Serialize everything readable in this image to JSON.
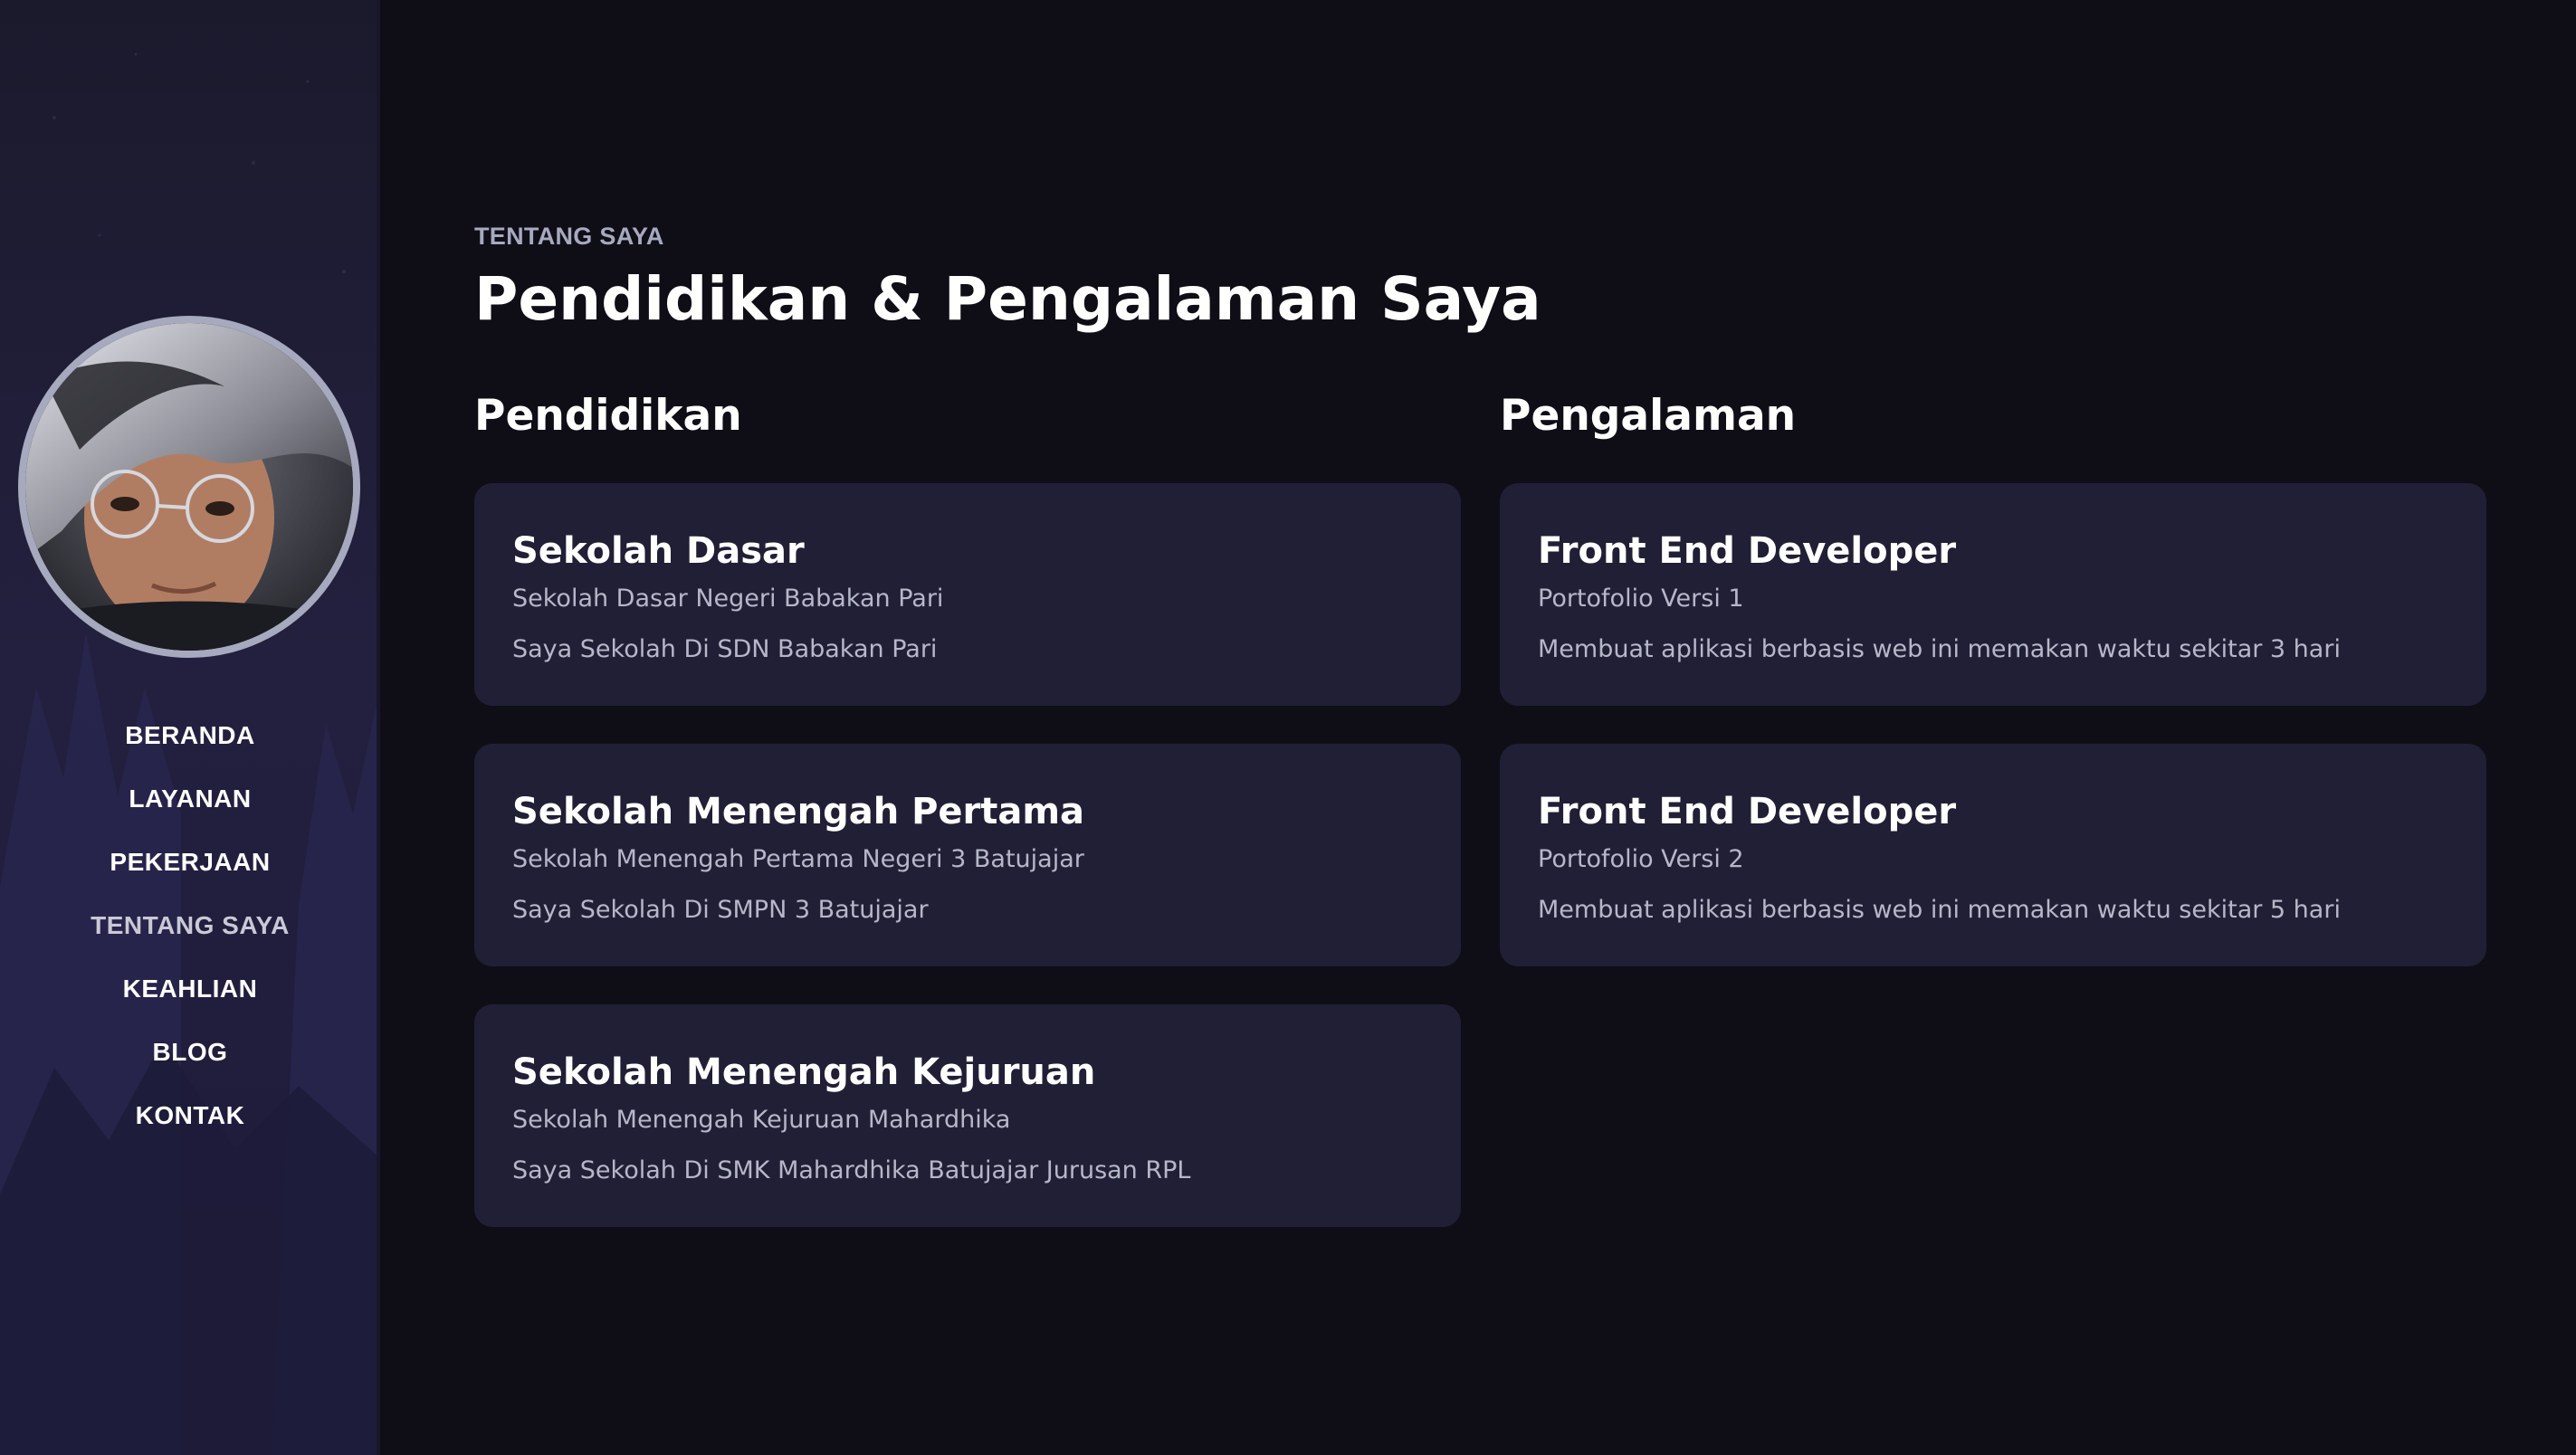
{
  "sidebar": {
    "avatar_alt": "profile photo",
    "nav": [
      {
        "label": "BERANDA",
        "active": false
      },
      {
        "label": "LAYANAN",
        "active": false
      },
      {
        "label": "PEKERJAAN",
        "active": false
      },
      {
        "label": "TENTANG SAYA",
        "active": true
      },
      {
        "label": "KEAHLIAN",
        "active": false
      },
      {
        "label": "BLOG",
        "active": false
      },
      {
        "label": "KONTAK",
        "active": false
      }
    ]
  },
  "main": {
    "eyebrow": "TENTANG SAYA",
    "title": "Pendidikan & Pengalaman Saya",
    "education": {
      "heading": "Pendidikan",
      "items": [
        {
          "title": "Sekolah Dasar",
          "subtitle": "Sekolah Dasar Negeri Babakan Pari",
          "description": "Saya Sekolah Di SDN Babakan Pari"
        },
        {
          "title": "Sekolah Menengah Pertama",
          "subtitle": "Sekolah Menengah Pertama Negeri 3 Batujajar",
          "description": "Saya Sekolah Di SMPN 3 Batujajar"
        },
        {
          "title": "Sekolah Menengah Kejuruan",
          "subtitle": "Sekolah Menengah Kejuruan Mahardhika",
          "description": "Saya Sekolah Di SMK Mahardhika Batujajar Jurusan RPL"
        }
      ]
    },
    "experience": {
      "heading": "Pengalaman",
      "items": [
        {
          "title": "Front End Developer",
          "subtitle": "Portofolio Versi 1",
          "description": "Membuat aplikasi berbasis web ini memakan waktu sekitar 3 hari"
        },
        {
          "title": "Front End Developer",
          "subtitle": "Portofolio Versi 2",
          "description": "Membuat aplikasi berbasis web ini memakan waktu sekitar 5 hari"
        }
      ]
    }
  },
  "colors": {
    "background": "#0f0e17",
    "sidebar": "#23203f",
    "card": "#211f35",
    "heading": "#fffffe",
    "paragraph": "#b6b7c9",
    "muted": "#a7a9be"
  }
}
